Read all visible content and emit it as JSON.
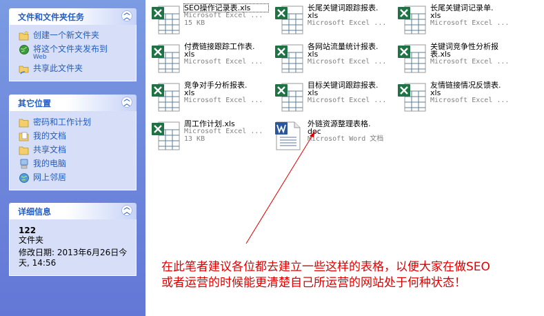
{
  "sidebar": {
    "tasks": {
      "title": "文件和文件夹任务",
      "items": [
        {
          "label": "创建一个新文件夹",
          "icon": "new-folder-icon"
        },
        {
          "label": "将这个文件夹发布到",
          "sub": "Web",
          "icon": "publish-web-icon"
        },
        {
          "label": "共享此文件夹",
          "icon": "share-folder-icon"
        }
      ]
    },
    "places": {
      "title": "其它位置",
      "items": [
        {
          "label": "密码和工作计划",
          "icon": "folder-icon"
        },
        {
          "label": "我的文档",
          "icon": "my-documents-icon"
        },
        {
          "label": "共享文档",
          "icon": "shared-folder-icon"
        },
        {
          "label": "我的电脑",
          "icon": "my-computer-icon"
        },
        {
          "label": "网上邻居",
          "icon": "network-icon"
        }
      ]
    },
    "details": {
      "title": "详细信息",
      "name": "122",
      "type": "文件夹",
      "modified_line1": "修改日期: 2013年6月26日今",
      "modified_line2": "天, 14:56"
    }
  },
  "files": [
    {
      "name1": "SEO操作记录表.xls",
      "name2": "",
      "type": "Microsoft Excel ...",
      "size": "15 KB",
      "icon": "excel-icon",
      "focused": true
    },
    {
      "name1": "长尾关键词跟踪报表.",
      "name2": "xls",
      "type": "Microsoft Excel ...",
      "size": "",
      "icon": "excel-icon"
    },
    {
      "name1": "长尾关键词记录单.",
      "name2": "xls",
      "type": "Microsoft Excel ...",
      "size": "",
      "icon": "excel-icon"
    },
    {
      "name1": "付费链接跟踪工作表.",
      "name2": "xls",
      "type": "Microsoft Excel ...",
      "size": "",
      "icon": "excel-icon"
    },
    {
      "name1": "各网站流量统计报表.",
      "name2": "xls",
      "type": "Microsoft Excel ...",
      "size": "",
      "icon": "excel-icon"
    },
    {
      "name1": "关键词竞争性分析报",
      "name2": "表.xls",
      "type": "Microsoft Excel ...",
      "size": "",
      "icon": "excel-icon"
    },
    {
      "name1": "竞争对手分析报表.",
      "name2": "xls",
      "type": "Microsoft Excel ...",
      "size": "",
      "icon": "excel-icon"
    },
    {
      "name1": "目标关键词跟踪报表.",
      "name2": "xls",
      "type": "Microsoft Excel ...",
      "size": "",
      "icon": "excel-icon"
    },
    {
      "name1": "友情链接情况反馈表.",
      "name2": "xls",
      "type": "Microsoft Excel ...",
      "size": "",
      "icon": "excel-icon"
    },
    {
      "name1": "周工作计划.xls",
      "name2": "",
      "type": "Microsoft Excel ...",
      "size": "13 KB",
      "icon": "excel-icon"
    },
    {
      "name1": "外链资源整理表格.",
      "name2": "doc",
      "type": "Microsoft Word 文档",
      "size": "",
      "icon": "word-icon"
    }
  ],
  "annotation": {
    "line1": "在此笔者建议各位都去建立一些这样的表格，以便大家在做SEO",
    "line2": "或者运营的时候能更清楚自己所运营的网站处于何种状态！",
    "color": "#e00000"
  },
  "colors": {
    "sidebar": "#6f89dc",
    "link": "#215dc6",
    "excel": "#1f7244",
    "word": "#2b579a"
  }
}
